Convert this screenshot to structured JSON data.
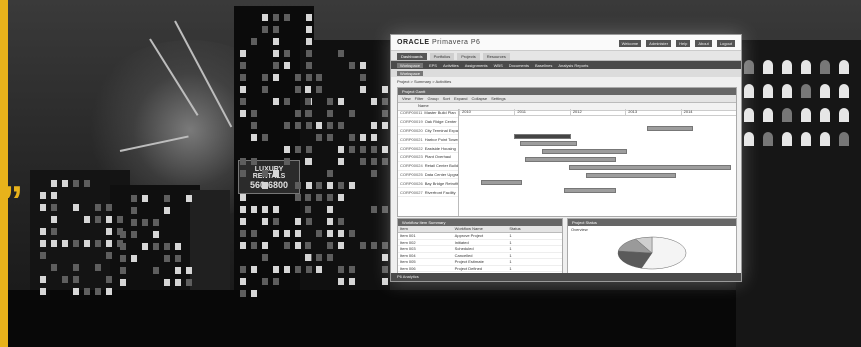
{
  "brand": {
    "accent_color": "#e8b21b",
    "quote_glyph": "”"
  },
  "scene": {
    "billboard_line1": "LUXURY RENTALS",
    "billboard_line2": "560-6800"
  },
  "app": {
    "logo_vendor": "ORACLE",
    "logo_product": "Primavera P6",
    "user_links": [
      "Welcome",
      "Administer",
      "Help",
      "About",
      "Logout"
    ],
    "top_tabs": [
      {
        "label": "Dashboards",
        "active": true
      },
      {
        "label": "Portfolios",
        "active": false
      },
      {
        "label": "Projects",
        "active": false
      },
      {
        "label": "Resources",
        "active": false
      }
    ],
    "sub_nav": [
      {
        "label": "Workspace",
        "active": true
      },
      {
        "label": "EPS",
        "active": false
      },
      {
        "label": "Activities",
        "active": false
      },
      {
        "label": "Assignments",
        "active": false
      },
      {
        "label": "WBS",
        "active": false
      },
      {
        "label": "Documents",
        "active": false
      },
      {
        "label": "Baselines",
        "active": false
      },
      {
        "label": "Analysis Reports",
        "active": false
      }
    ],
    "tool_label": "Workspace",
    "breadcrumb": "Project > Summary > Activities",
    "gantt": {
      "title": "Project Gantt",
      "toolbar": [
        "View",
        "Filter",
        "Group",
        "Sort",
        "Expand",
        "Collapse",
        "Settings"
      ],
      "name_header": "Name",
      "years": [
        "2010",
        "2011",
        "2012",
        "2013",
        "2014"
      ],
      "rows": [
        {
          "id": "CORP00011",
          "name": "Master Build Plan"
        },
        {
          "id": "CORP00019",
          "name": "Oak Ridge Center"
        },
        {
          "id": "CORP00020",
          "name": "City Terminal Expansion"
        },
        {
          "id": "CORP00021",
          "name": "Harbor Point Tower"
        },
        {
          "id": "CORP00022",
          "name": "Eastside Housing"
        },
        {
          "id": "CORP00023",
          "name": "Plant Overhaul"
        },
        {
          "id": "CORP00024",
          "name": "Retail Center Build"
        },
        {
          "id": "CORP00025",
          "name": "Data Center Upgrade"
        },
        {
          "id": "CORP00026",
          "name": "Bay Bridge Retrofit"
        },
        {
          "id": "CORP00027",
          "name": "Riverfront Facility"
        }
      ],
      "bars": [
        {
          "row": 1,
          "start": 0.68,
          "end": 0.84,
          "dark": false
        },
        {
          "row": 2,
          "start": 0.2,
          "end": 0.4,
          "dark": true
        },
        {
          "row": 3,
          "start": 0.22,
          "end": 0.42,
          "dark": false
        },
        {
          "row": 4,
          "start": 0.3,
          "end": 0.6,
          "dark": false
        },
        {
          "row": 5,
          "start": 0.24,
          "end": 0.56,
          "dark": false
        },
        {
          "row": 6,
          "start": 0.4,
          "end": 0.98,
          "dark": false
        },
        {
          "row": 7,
          "start": 0.46,
          "end": 0.78,
          "dark": false
        },
        {
          "row": 8,
          "start": 0.08,
          "end": 0.22,
          "dark": false
        },
        {
          "row": 9,
          "start": 0.38,
          "end": 0.56,
          "dark": false
        }
      ]
    },
    "left_panel": {
      "title": "Workflow Item Summary",
      "headers": [
        "Item",
        "Workflow Name",
        "Status"
      ],
      "rows": [
        [
          "Item 001",
          "Approve Project",
          "1"
        ],
        [
          "Item 002",
          "Initiated",
          "1"
        ],
        [
          "Item 003",
          "Scheduled",
          "1"
        ],
        [
          "Item 004",
          "Cancelled",
          "1"
        ],
        [
          "Item 005",
          "Project Estimate",
          "1"
        ],
        [
          "Item 006",
          "Project Defined",
          "1"
        ],
        [
          "Item 007",
          "Project Launch",
          "1"
        ],
        [
          "Item 008",
          "Approve Project",
          "1"
        ],
        [
          "Item 009",
          "Design Management",
          "1"
        ]
      ]
    },
    "right_panel": {
      "title": "Project Status",
      "chart_caption": "Overview"
    },
    "footer_label": "P6 Analytics"
  },
  "chart_data": {
    "type": "pie",
    "title": "",
    "slices": [
      {
        "label": "",
        "value": 55,
        "color": "#f4f4f4"
      },
      {
        "label": "",
        "value": 22,
        "color": "#5a5a5a"
      },
      {
        "label": "",
        "value": 15,
        "color": "#9a9a9a"
      },
      {
        "label": "",
        "value": 8,
        "color": "#cfcfcf"
      }
    ]
  }
}
